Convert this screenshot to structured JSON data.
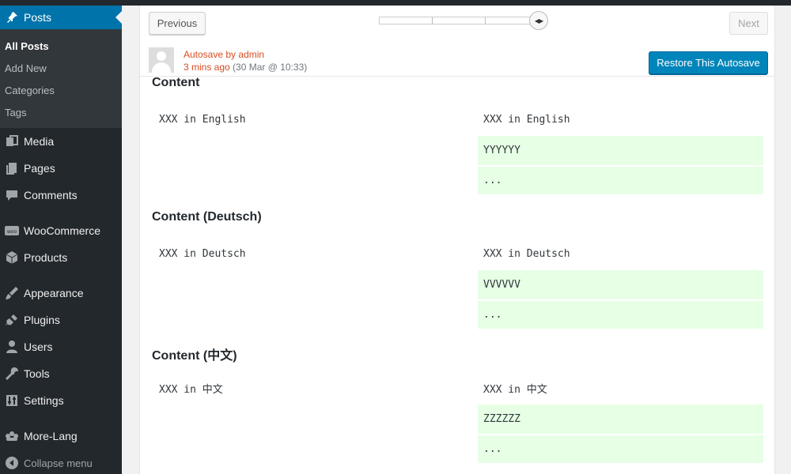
{
  "sidebar": {
    "current": {
      "label": "Posts",
      "icon": "pushpin-icon"
    },
    "submenu": [
      {
        "label": "All Posts",
        "active": true
      },
      {
        "label": "Add New",
        "active": false
      },
      {
        "label": "Categories",
        "active": false
      },
      {
        "label": "Tags",
        "active": false
      }
    ],
    "items": [
      {
        "label": "Media",
        "icon": "media-icon"
      },
      {
        "label": "Pages",
        "icon": "pages-icon"
      },
      {
        "label": "Comments",
        "icon": "comments-icon"
      },
      {
        "label": "WooCommerce",
        "icon": "woocommerce-icon"
      },
      {
        "label": "Products",
        "icon": "products-icon"
      },
      {
        "label": "Appearance",
        "icon": "brush-icon"
      },
      {
        "label": "Plugins",
        "icon": "plugin-icon"
      },
      {
        "label": "Users",
        "icon": "users-icon"
      },
      {
        "label": "Tools",
        "icon": "wrench-icon"
      },
      {
        "label": "Settings",
        "icon": "settings-icon"
      },
      {
        "label": "More-Lang",
        "icon": "more-lang-icon"
      }
    ],
    "collapse_label": "Collapse menu"
  },
  "revisions": {
    "previous_label": "Previous",
    "next_label": "Next",
    "restore_label": "Restore This Autosave",
    "author_prefix": "Autosave by",
    "author_name": "admin",
    "relative_time": "3 mins ago",
    "absolute_time": "(30 Mar @ 10:33)"
  },
  "diff": [
    {
      "title": "Content",
      "left": "XXX in English",
      "right_context": "XXX in English",
      "added": [
        "YYYYYY",
        "..."
      ]
    },
    {
      "title": "Content (Deutsch)",
      "left": "XXX in Deutsch",
      "right_context": "XXX in Deutsch",
      "added": [
        "VVVVVV",
        "..."
      ]
    },
    {
      "title": "Content (中文)",
      "left": "XXX in 中文",
      "right_context": "XXX in 中文",
      "added": [
        "ZZZZZZ",
        "..."
      ]
    }
  ],
  "colors": {
    "accent": "#0073aa",
    "added_bg": "#e6ffe5",
    "sidebar_bg": "#23282d",
    "author_link": "#d54e21"
  }
}
